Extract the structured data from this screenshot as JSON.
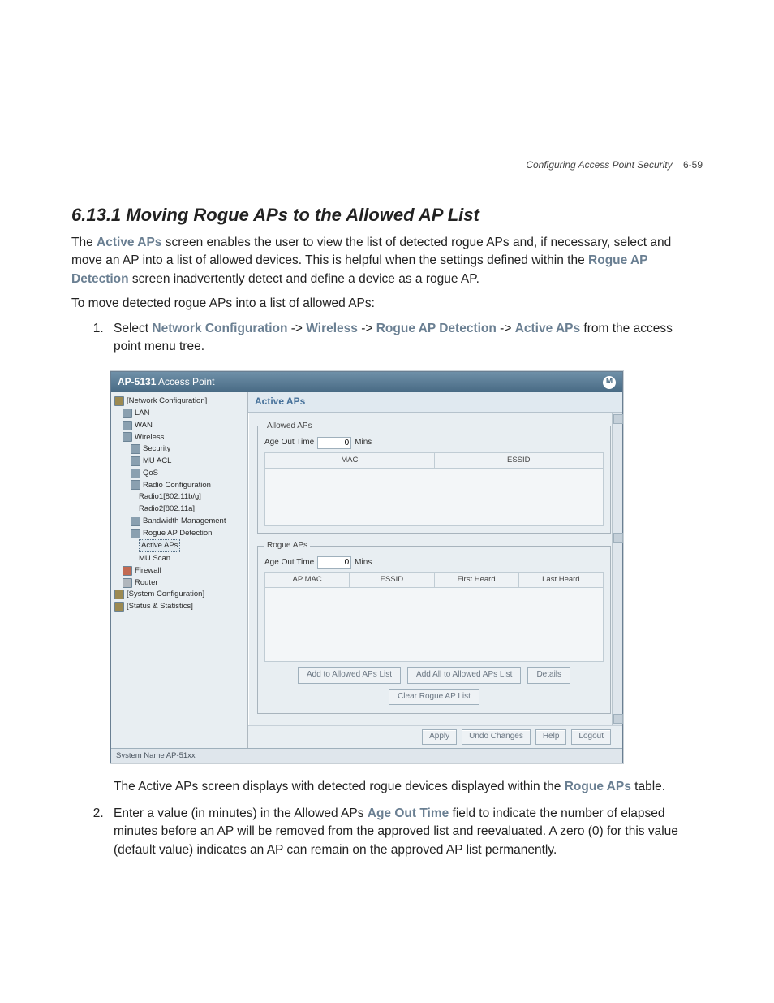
{
  "header": {
    "running": "Configuring Access Point Security",
    "pagenum": "6-59"
  },
  "section": {
    "number": "6.13.1",
    "title": "Moving Rogue APs to the Allowed AP List"
  },
  "para1": {
    "pre": "The ",
    "hl1": "Active APs",
    "mid": " screen enables the user to view the list of detected rogue APs and, if necessary, select and move an AP into a list of allowed devices. This is helpful when the settings defined within the ",
    "hl2": "Rogue AP Detection",
    "post": " screen inadvertently detect and define a device as a rogue AP."
  },
  "para2": "To move detected rogue APs into a list of allowed APs:",
  "steps": {
    "s1": {
      "pre": "Select ",
      "b1": "Network Configuration",
      "a1": " -> ",
      "b2": "Wireless",
      "a2": " -> ",
      "b3": "Rogue AP Detection",
      "a3": " -> ",
      "b4": "Active APs",
      "post": " from the access point menu tree."
    },
    "s1_after": {
      "pre": "The Active APs screen displays with detected rogue devices displayed within the ",
      "hl": "Rogue APs",
      "post": " table."
    },
    "s2": {
      "pre": "Enter a value (in minutes) in the Allowed APs ",
      "hl": "Age Out Time",
      "post": " field to indicate the number of elapsed minutes before an AP will be removed from the approved list and reevaluated. A zero (0) for this value (default value) indicates an AP can remain on the approved AP list permanently."
    }
  },
  "app": {
    "title_model": "AP-5131",
    "title_rest": " Access Point",
    "tree": {
      "n0": "[Network Configuration]",
      "lan": "LAN",
      "wan": "WAN",
      "wl": "Wireless",
      "sec": "Security",
      "muacl": "MU ACL",
      "qos": "QoS",
      "radio": "Radio Configuration",
      "r1": "Radio1[802.11b/g]",
      "r2": "Radio2[802.11a]",
      "bwm": "Bandwidth Management",
      "rogue": "Rogue AP Detection",
      "active": "Active APs",
      "muscan": "MU Scan",
      "fw": "Firewall",
      "router": "Router",
      "sys": "[System Configuration]",
      "stats": "[Status & Statistics]"
    },
    "panel_title": "Active APs",
    "allowed": {
      "legend": "Allowed APs",
      "age_label": "Age Out Time",
      "age_val": "0",
      "age_unit": "Mins",
      "col_mac": "MAC",
      "col_essid": "ESSID"
    },
    "rogue": {
      "legend": "Rogue APs",
      "age_label": "Age Out Time",
      "age_val": "0",
      "age_unit": "Mins",
      "col_apmac": "AP MAC",
      "col_essid": "ESSID",
      "col_first": "First Heard",
      "col_last": "Last Heard"
    },
    "buttons": {
      "add": "Add to Allowed APs List",
      "addall": "Add All to Allowed APs List",
      "details": "Details",
      "clear": "Clear Rogue AP List",
      "apply": "Apply",
      "undo": "Undo Changes",
      "help": "Help",
      "logout": "Logout"
    },
    "status": "System Name AP-51xx"
  }
}
